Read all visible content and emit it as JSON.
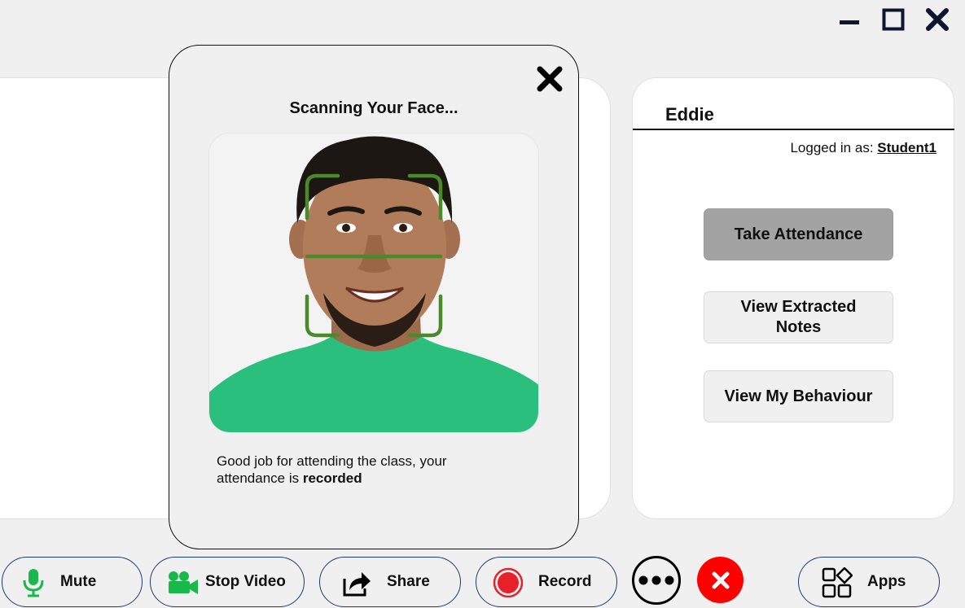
{
  "window": {
    "minimize_icon": "minimize-icon",
    "maximize_icon": "maximize-icon",
    "close_icon": "close-icon"
  },
  "sidebar": {
    "name": "Eddie",
    "logged_in_label": "Logged in as: ",
    "username": "Student1",
    "buttons": {
      "take_attendance": "Take Attendance",
      "view_notes": "View Extracted Notes",
      "view_behaviour": "View My Behaviour"
    }
  },
  "modal": {
    "title": "Scanning Your Face...",
    "message_prefix": "Good job for attending the class, your attendance is ",
    "message_bold": "recorded"
  },
  "toolbar": {
    "mute": "Mute",
    "stop_video": "Stop Video",
    "share": "Share",
    "record": "Record",
    "apps": "Apps"
  },
  "colors": {
    "accent_green": "#18b84a",
    "record_red": "#e8202a",
    "end_call_red": "#ff0000",
    "scan_frame": "#4a8a2a",
    "shirt_green": "#2bbf7e",
    "toolbar_border": "#1e3a6e",
    "active_button": "#a3a3a3"
  }
}
